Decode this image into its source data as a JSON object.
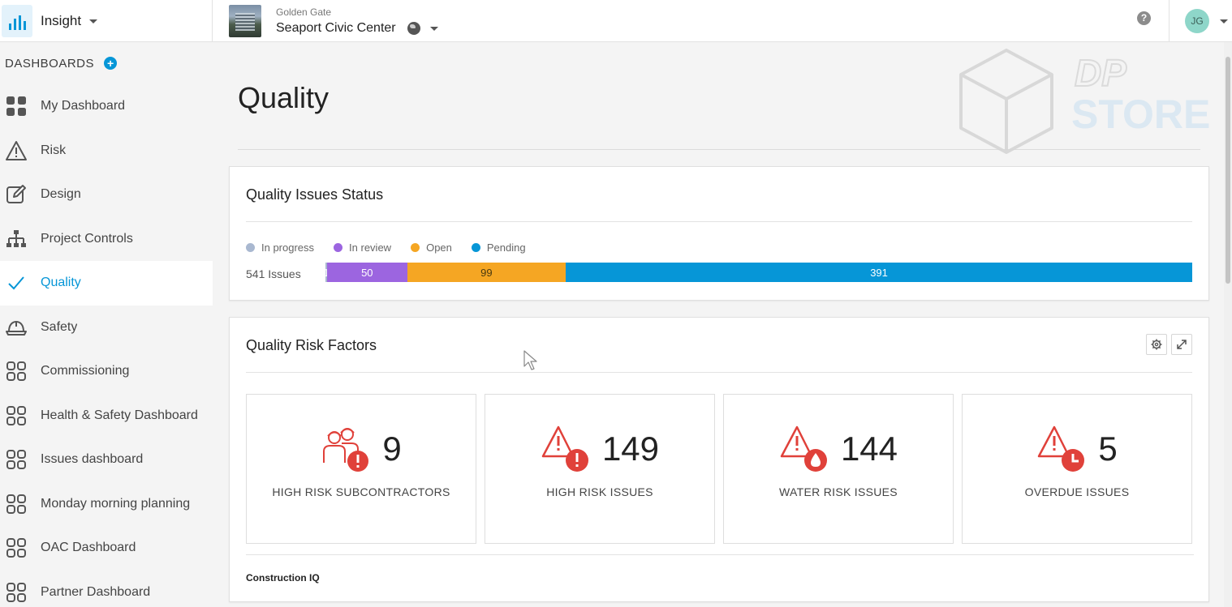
{
  "header": {
    "app_name": "Insight",
    "project_account": "Golden Gate",
    "project_name": "Seaport Civic Center",
    "help_label": "?",
    "user_initials": "JG"
  },
  "sidebar": {
    "title": "DASHBOARDS",
    "add_label": "+",
    "items": [
      {
        "label": "My Dashboard",
        "icon": "grid-icon"
      },
      {
        "label": "Risk",
        "icon": "warning-icon"
      },
      {
        "label": "Design",
        "icon": "pencil-icon"
      },
      {
        "label": "Project Controls",
        "icon": "hierarchy-icon"
      },
      {
        "label": "Quality",
        "icon": "checkmark-icon",
        "active": true
      },
      {
        "label": "Safety",
        "icon": "hard-hat-icon"
      },
      {
        "label": "Commissioning",
        "icon": "dashboard-grid-icon"
      },
      {
        "label": "Health & Safety Dashboard",
        "icon": "dashboard-grid-icon"
      },
      {
        "label": "Issues dashboard",
        "icon": "dashboard-grid-icon"
      },
      {
        "label": "Monday morning planning",
        "icon": "dashboard-grid-icon"
      },
      {
        "label": "OAC Dashboard",
        "icon": "dashboard-grid-icon"
      },
      {
        "label": "Partner Dashboard",
        "icon": "dashboard-grid-icon"
      }
    ]
  },
  "main": {
    "page_title": "Quality",
    "status_card": {
      "title": "Quality Issues Status",
      "legend": [
        {
          "label": "In progress",
          "color": "#a9b8d0"
        },
        {
          "label": "In review",
          "color": "#9c65e0"
        },
        {
          "label": "Open",
          "color": "#f5a623"
        },
        {
          "label": "Pending",
          "color": "#0696d7"
        }
      ],
      "issues_count": "541 Issues",
      "segments": [
        {
          "label": "1",
          "value": 1,
          "color": "#a9b8d0"
        },
        {
          "label": "50",
          "value": 50,
          "color": "#9c65e0"
        },
        {
          "label": "99",
          "value": 99,
          "color": "#f5a623"
        },
        {
          "label": "391",
          "value": 391,
          "color": "#0696d7"
        }
      ]
    },
    "risk_card": {
      "title": "Quality Risk Factors",
      "tiles": [
        {
          "value": "9",
          "label": "HIGH RISK SUBCONTRACTORS",
          "icon": "subcontractor-alert-icon"
        },
        {
          "value": "149",
          "label": "HIGH RISK ISSUES",
          "icon": "warning-alert-icon"
        },
        {
          "value": "144",
          "label": "WATER RISK ISSUES",
          "icon": "warning-water-icon"
        },
        {
          "value": "5",
          "label": "OVERDUE ISSUES",
          "icon": "warning-clock-icon"
        }
      ],
      "footer_brand": "Construction IQ"
    },
    "accent_color": "#0696d7",
    "alert_color": "#e0413a"
  },
  "watermark": {
    "line1": "DP",
    "line2": "STORE"
  }
}
